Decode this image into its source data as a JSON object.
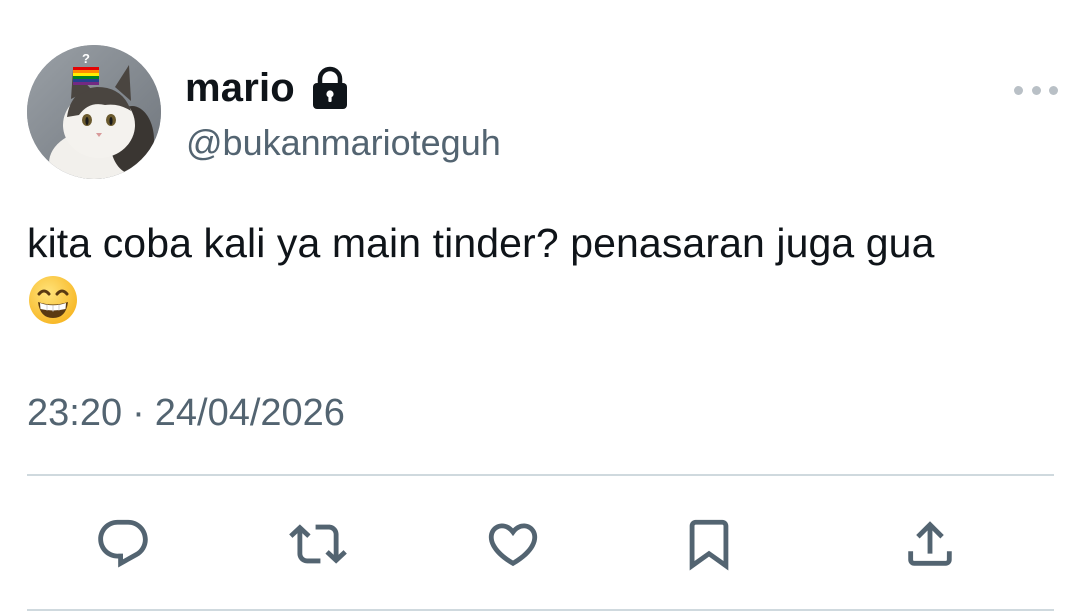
{
  "author": {
    "display_name": "mario",
    "handle": "@bukanmarioteguh",
    "protected": true,
    "avatar_badge": "?"
  },
  "tweet": {
    "text": "kita coba kali ya main tinder? penasaran juga gua",
    "emoji": "grinning-face-with-smiling-eyes",
    "time": "23:20",
    "separator": "·",
    "date": "24/04/2026"
  },
  "icons": {
    "more": "more-horizontal-icon",
    "lock": "lock-icon",
    "reply": "reply-icon",
    "retweet": "retweet-icon",
    "like": "heart-icon",
    "bookmark": "bookmark-icon",
    "share": "share-icon"
  },
  "colors": {
    "text_primary": "#0f1419",
    "text_secondary": "#536471",
    "divider": "#cfd9de",
    "icon": "#536471"
  }
}
